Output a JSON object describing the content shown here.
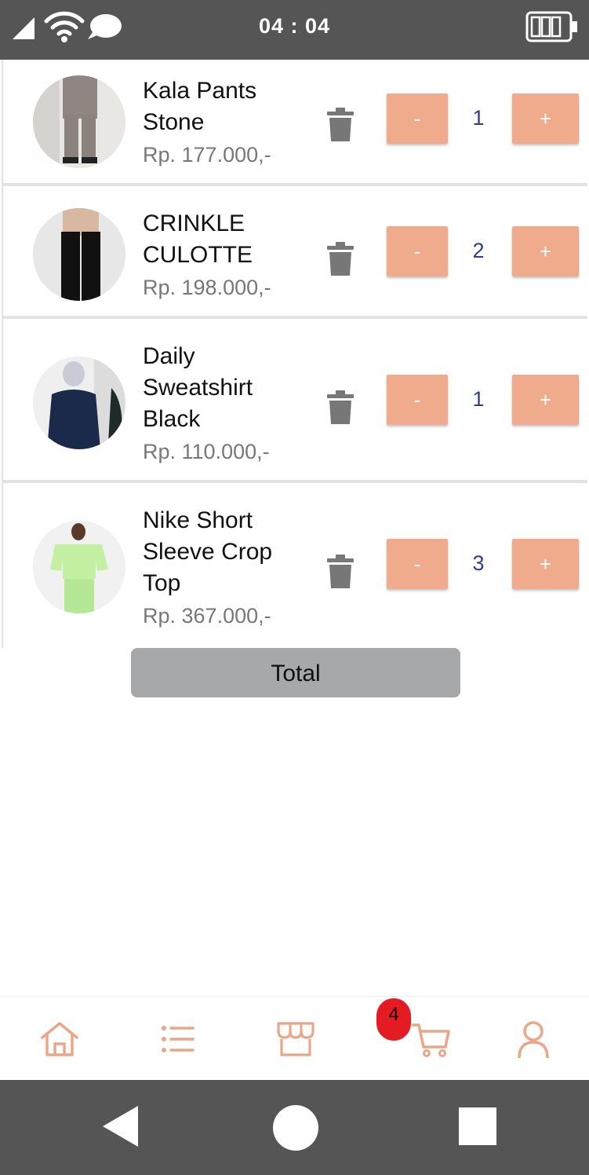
{
  "status_bar": {
    "time": "04 : 04",
    "icons": [
      "signal-icon",
      "wifi-icon",
      "message-icon",
      "battery-icon"
    ]
  },
  "cart": {
    "items": [
      {
        "name": "Kala Pants\nStone",
        "price": "Rp. 177.000,-",
        "quantity": "1",
        "minus_label": "-",
        "plus_label": "+"
      },
      {
        "name": "CRINKLE\nCULOTTE",
        "price": "Rp. 198.000,-",
        "quantity": "2",
        "minus_label": "-",
        "plus_label": "+"
      },
      {
        "name": " Daily\nSweatshirt\nBlack",
        "price": "Rp. 110.000,-",
        "quantity": "1",
        "minus_label": "-",
        "plus_label": "+"
      },
      {
        "name": "Nike Short\nSleeve Crop\nTop",
        "price": "Rp. 367.000,-",
        "quantity": "3",
        "minus_label": "-",
        "plus_label": "+"
      }
    ]
  },
  "total_button": {
    "label": "Total"
  },
  "bottom_nav": {
    "items": [
      "home-icon",
      "list-icon",
      "store-icon",
      "cart-icon",
      "profile-icon"
    ],
    "cart_badge": "4"
  },
  "colors": {
    "accent": "#f0ab8c",
    "quantity_text": "#2f3d93",
    "badge": "#e41b23",
    "system_bar": "#555555",
    "total_button": "#a7a8aa"
  }
}
